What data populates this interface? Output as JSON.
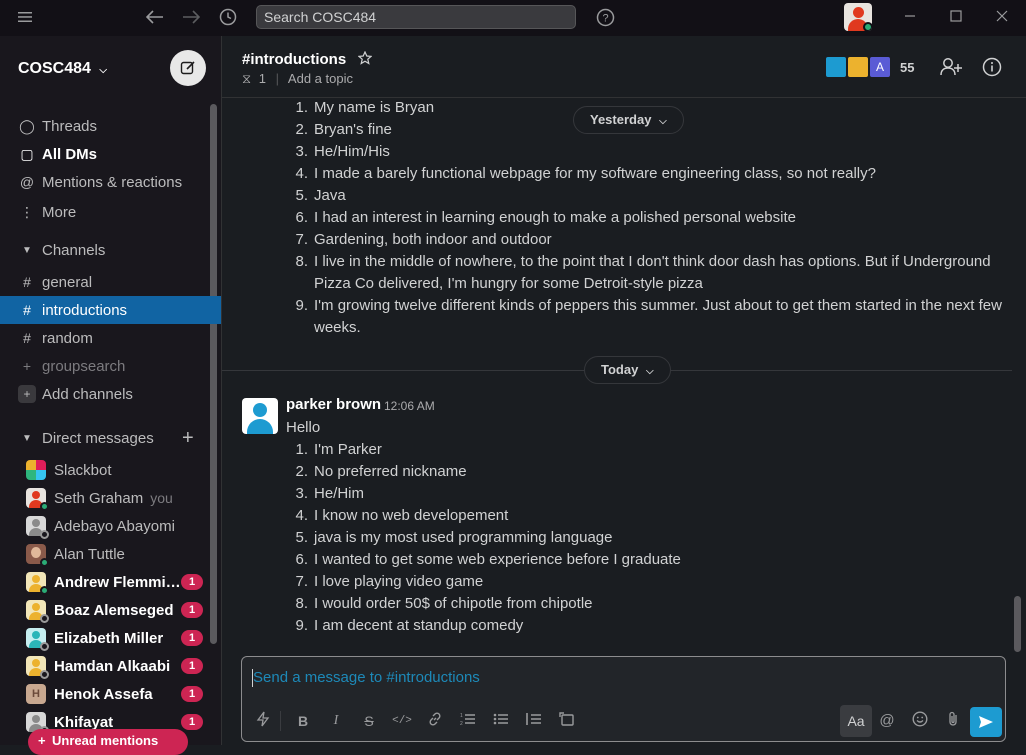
{
  "topbar": {
    "search_placeholder": "Search COSC484"
  },
  "sidebar": {
    "workspace": "COSC484",
    "nav": [
      {
        "label": "Threads",
        "icon": "threads-icon"
      },
      {
        "label": "All DMs",
        "icon": "dms-icon"
      },
      {
        "label": "Mentions & reactions",
        "icon": "at-icon"
      },
      {
        "label": "More",
        "icon": "more-vertical-icon"
      }
    ],
    "channels_header": "Channels",
    "channels": [
      {
        "label": "general"
      },
      {
        "label": "introductions"
      },
      {
        "label": "random"
      },
      {
        "label": "groupsearch"
      }
    ],
    "add_channels": "Add channels",
    "dm_header": "Direct messages",
    "dms": [
      {
        "name": "Slackbot",
        "badge": ""
      },
      {
        "name": "Seth Graham",
        "suffix": "you",
        "badge": ""
      },
      {
        "name": "Adebayo Abayomi",
        "badge": ""
      },
      {
        "name": "Alan Tuttle",
        "badge": ""
      },
      {
        "name": "Andrew Flemmi…",
        "badge": "1"
      },
      {
        "name": "Boaz Alemseged",
        "badge": "1"
      },
      {
        "name": "Elizabeth Miller",
        "badge": "1"
      },
      {
        "name": "Hamdan Alkaabi",
        "badge": "1"
      },
      {
        "name": "Henok Assefa",
        "badge": "1"
      },
      {
        "name": "Khifayat",
        "badge": "1"
      }
    ],
    "unread_pill": "Unread mentions"
  },
  "header": {
    "channel": "#introductions",
    "pins": "1",
    "add_topic": "Add a topic",
    "member_count": "55"
  },
  "messages": {
    "prev_items": [
      {
        "n": "1.",
        "text": "My name is Bryan"
      },
      {
        "n": "2.",
        "text": "Bryan's fine"
      },
      {
        "n": "3.",
        "text": "He/Him/His"
      },
      {
        "n": "4.",
        "text": "I made a barely functional webpage for my software engineering class, so not really?"
      },
      {
        "n": "5.",
        "text": "Java"
      },
      {
        "n": "6.",
        "text": "I had an interest in learning enough to make a polished personal website"
      },
      {
        "n": "7.",
        "text": "Gardening, both indoor and outdoor"
      },
      {
        "n": "8.",
        "text": "I live in the middle of nowhere, to the point that I don't think door dash has options. But if Underground"
      },
      {
        "n": "",
        "text": "Pizza Co delivered, I'm hungry for some Detroit-style pizza"
      },
      {
        "n": "9.",
        "text": "I'm growing twelve different kinds of peppers this summer. Just about to get them started in the next few"
      },
      {
        "n": "",
        "text": "weeks."
      }
    ],
    "day_yesterday": "Yesterday",
    "day_today": "Today",
    "sender": "parker brown",
    "time": "12:06 AM",
    "greeting": "Hello",
    "items": [
      {
        "n": "1.",
        "text": "I'm Parker"
      },
      {
        "n": "2.",
        "text": "No preferred nickname"
      },
      {
        "n": "3.",
        "text": "He/Him"
      },
      {
        "n": "4.",
        "text": "I know no web developement"
      },
      {
        "n": "5.",
        "text": "java is my most used programming language"
      },
      {
        "n": "6.",
        "text": "I wanted to get some web experience before I graduate"
      },
      {
        "n": "7.",
        "text": "I love playing video game"
      },
      {
        "n": "8.",
        "text": "I would order 50$ of chipotle from chipotle"
      },
      {
        "n": "9.",
        "text": "I am decent at standup comedy"
      }
    ]
  },
  "composer": {
    "placeholder": "Send a message to #introductions",
    "aa_label": "Aa"
  }
}
